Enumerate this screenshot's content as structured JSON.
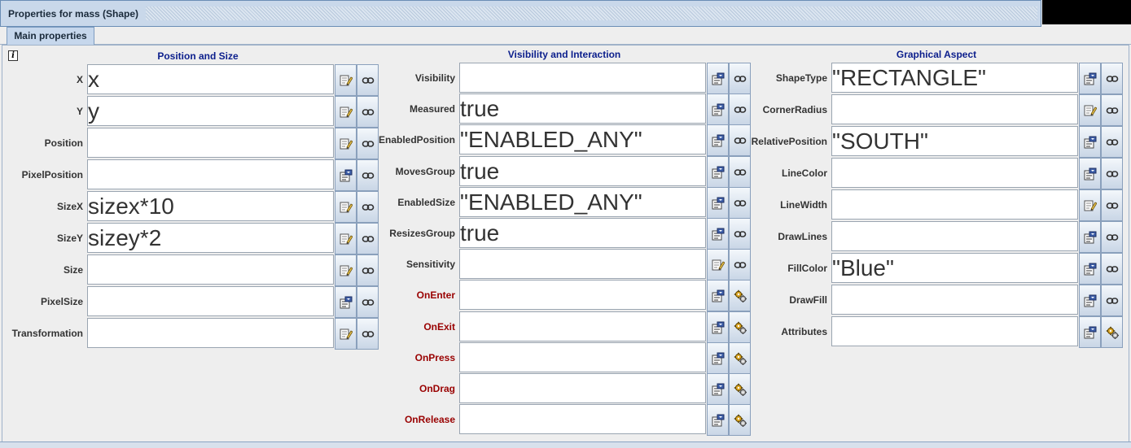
{
  "window": {
    "title": "Properties for mass (Shape)"
  },
  "tabs": [
    {
      "label": "Main properties"
    }
  ],
  "columns": [
    {
      "header": "Position and Size",
      "rows": [
        {
          "label": "X",
          "value": "x",
          "edit_icon": "edit-pencil-icon",
          "link_icon": "link-icon"
        },
        {
          "label": "Y",
          "value": "y",
          "edit_icon": "edit-pencil-icon",
          "link_icon": "link-icon"
        },
        {
          "label": "Position",
          "value": "",
          "edit_icon": "edit-pencil-icon",
          "link_icon": "link-icon"
        },
        {
          "label": "PixelPosition",
          "value": "",
          "edit_icon": "options-list-icon",
          "link_icon": "link-icon"
        },
        {
          "label": "SizeX",
          "value": "sizex*10",
          "edit_icon": "edit-pencil-icon",
          "link_icon": "link-icon"
        },
        {
          "label": "SizeY",
          "value": "sizey*2",
          "edit_icon": "edit-pencil-icon",
          "link_icon": "link-icon"
        },
        {
          "label": "Size",
          "value": "",
          "edit_icon": "edit-pencil-icon",
          "link_icon": "link-icon"
        },
        {
          "label": "PixelSize",
          "value": "",
          "edit_icon": "options-list-icon",
          "link_icon": "link-icon"
        },
        {
          "label": "Transformation",
          "value": "",
          "edit_icon": "edit-pencil-icon",
          "link_icon": "link-icon"
        }
      ]
    },
    {
      "header": "Visibility and Interaction",
      "rows": [
        {
          "label": "Visibility",
          "value": "",
          "edit_icon": "options-list-icon",
          "link_icon": "link-icon"
        },
        {
          "label": "Measured",
          "value": "true",
          "edit_icon": "options-list-icon",
          "link_icon": "link-icon"
        },
        {
          "label": "EnabledPosition",
          "value": "\"ENABLED_ANY\"",
          "edit_icon": "options-list-icon",
          "link_icon": "link-icon"
        },
        {
          "label": "MovesGroup",
          "value": "true",
          "edit_icon": "options-list-icon",
          "link_icon": "link-icon"
        },
        {
          "label": "EnabledSize",
          "value": "\"ENABLED_ANY\"",
          "edit_icon": "options-list-icon",
          "link_icon": "link-icon"
        },
        {
          "label": "ResizesGroup",
          "value": "true",
          "edit_icon": "options-list-icon",
          "link_icon": "link-icon"
        },
        {
          "label": "Sensitivity",
          "value": "",
          "edit_icon": "edit-pencil-icon",
          "link_icon": "link-icon"
        },
        {
          "label": "OnEnter",
          "value": "",
          "edit_icon": "options-list-icon",
          "link_icon": "gears-icon",
          "event": true
        },
        {
          "label": "OnExit",
          "value": "",
          "edit_icon": "options-list-icon",
          "link_icon": "gears-icon",
          "event": true
        },
        {
          "label": "OnPress",
          "value": "",
          "edit_icon": "options-list-icon",
          "link_icon": "gears-icon",
          "event": true
        },
        {
          "label": "OnDrag",
          "value": "",
          "edit_icon": "options-list-icon",
          "link_icon": "gears-icon",
          "event": true
        },
        {
          "label": "OnRelease",
          "value": "",
          "edit_icon": "options-list-icon",
          "link_icon": "gears-icon",
          "event": true
        }
      ]
    },
    {
      "header": "Graphical Aspect",
      "rows": [
        {
          "label": "ShapeType",
          "value": "\"RECTANGLE\"",
          "edit_icon": "options-list-icon",
          "link_icon": "link-icon"
        },
        {
          "label": "CornerRadius",
          "value": "",
          "edit_icon": "edit-pencil-icon",
          "link_icon": "link-icon"
        },
        {
          "label": "RelativePosition",
          "value": "\"SOUTH\"",
          "edit_icon": "options-list-icon",
          "link_icon": "link-icon"
        },
        {
          "label": "LineColor",
          "value": "",
          "edit_icon": "options-list-icon",
          "link_icon": "link-icon"
        },
        {
          "label": "LineWidth",
          "value": "",
          "edit_icon": "edit-pencil-icon",
          "link_icon": "link-icon"
        },
        {
          "label": "DrawLines",
          "value": "",
          "edit_icon": "options-list-icon",
          "link_icon": "link-icon"
        },
        {
          "label": "FillColor",
          "value": "\"Blue\"",
          "edit_icon": "options-list-icon",
          "link_icon": "link-icon"
        },
        {
          "label": "DrawFill",
          "value": "",
          "edit_icon": "options-list-icon",
          "link_icon": "link-icon"
        },
        {
          "label": "Attributes",
          "value": "",
          "edit_icon": "options-list-icon",
          "link_icon": "gears-icon"
        }
      ]
    }
  ],
  "colors": {
    "header_text": "#0b1e8c",
    "event_label": "#990000",
    "label": "#333333"
  }
}
